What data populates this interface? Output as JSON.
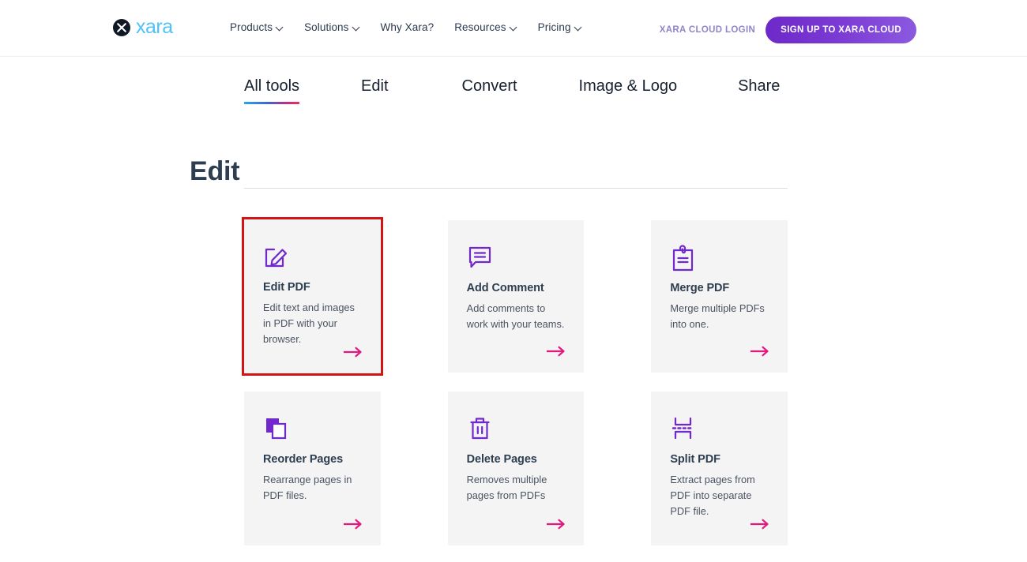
{
  "colors": {
    "brand_purple": "#7128cd",
    "accent_pink": "#e3197f",
    "selection_red": "#d11414",
    "logo_blue": "#4fc3f7",
    "heading_navy": "#2d3e50",
    "card_bg": "#f4f4f4"
  },
  "header": {
    "logo": {
      "mark_icon": "xara-x-circle-icon",
      "wordmark": "xara"
    },
    "nav_items": [
      {
        "label": "Products",
        "has_dropdown": true
      },
      {
        "label": "Solutions",
        "has_dropdown": true
      },
      {
        "label": "Why Xara?",
        "has_dropdown": false
      },
      {
        "label": "Resources",
        "has_dropdown": true
      },
      {
        "label": "Pricing",
        "has_dropdown": true
      }
    ],
    "login_label": "XARA CLOUD LOGIN",
    "signup_label": "SIGN UP TO XARA CLOUD"
  },
  "tabs": [
    {
      "label": "All tools",
      "active": true
    },
    {
      "label": "Edit",
      "active": false
    },
    {
      "label": "Convert",
      "active": false
    },
    {
      "label": "Image & Logo",
      "active": false
    },
    {
      "label": "Share",
      "active": false
    }
  ],
  "section": {
    "title": "Edit"
  },
  "cards": [
    {
      "title": "Edit PDF",
      "description": "Edit text and images in PDF with your browser.",
      "icon": "pencil-edit-square-icon",
      "arrow_icon": "arrow-right-icon",
      "selected": true
    },
    {
      "title": "Add Comment",
      "description": "Add comments to work with your teams.",
      "icon": "speech-bubble-comment-icon",
      "arrow_icon": "arrow-right-icon",
      "selected": false
    },
    {
      "title": "Merge PDF",
      "description": "Merge multiple PDFs into one.",
      "icon": "clipboard-merge-icon",
      "arrow_icon": "arrow-right-icon",
      "selected": false
    },
    {
      "title": "Reorder Pages",
      "description": "Rearrange pages in PDF files.",
      "icon": "stacked-pages-icon",
      "arrow_icon": "arrow-right-icon",
      "selected": false
    },
    {
      "title": "Delete Pages",
      "description": "Removes multiple pages from PDFs",
      "icon": "trash-can-icon",
      "arrow_icon": "arrow-right-icon",
      "selected": false
    },
    {
      "title": "Split PDF",
      "description": "Extract pages from PDF into separate PDF file.",
      "icon": "split-dashed-icon",
      "arrow_icon": "arrow-right-icon",
      "selected": false
    }
  ]
}
